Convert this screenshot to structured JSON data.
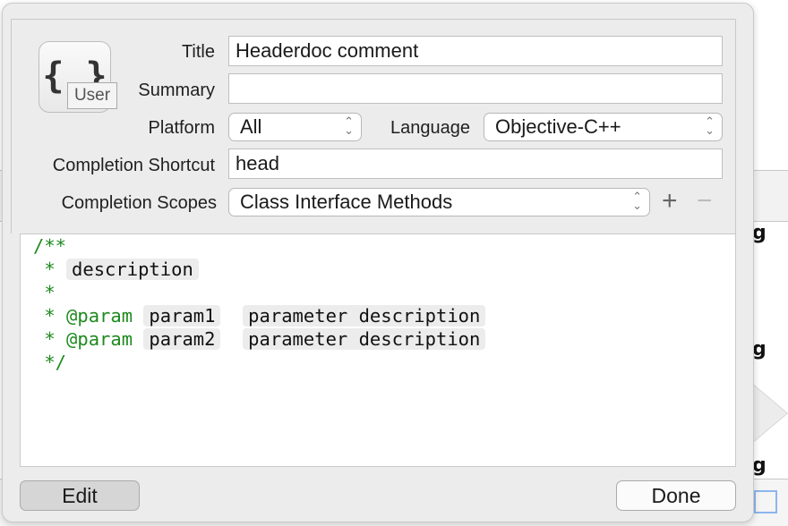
{
  "icon": {
    "glyph": "{ }",
    "tooltip": "User"
  },
  "form": {
    "title_label": "Title",
    "title_value": "Headerdoc comment",
    "summary_label": "Summary",
    "summary_value": "",
    "platform_label": "Platform",
    "platform_value": "All",
    "language_label": "Language",
    "language_value": "Objective-C++",
    "shortcut_label": "Completion Shortcut",
    "shortcut_value": "head",
    "scopes_label": "Completion Scopes",
    "scopes_value": "Class Interface Methods",
    "add": "+",
    "remove": "−"
  },
  "code": {
    "l1": "/**",
    "l2_prefix": " * ",
    "l2_tok": "description",
    "l3": " *",
    "l4_prefix": " * @param ",
    "l4_tok1": "param1",
    "l4_tok2": "parameter description",
    "l5_prefix": " * @param ",
    "l5_tok1": "param2",
    "l5_tok2": "parameter description",
    "l6": " */"
  },
  "buttons": {
    "edit": "Edit",
    "done": "Done"
  },
  "colors": {
    "comment": "#1e8a1e",
    "background": "#ececec"
  }
}
